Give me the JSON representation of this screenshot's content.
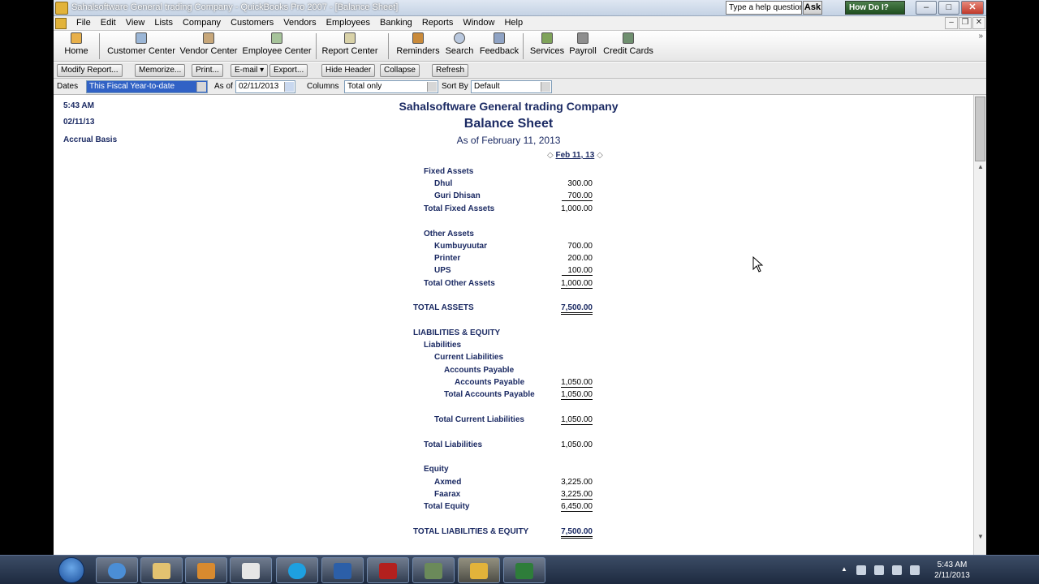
{
  "window": {
    "title": "Sahalsoftware General trading Company - QuickBooks Pro 2007 - [Balance Sheet]",
    "help_placeholder": "Type a help question",
    "ask_label": "Ask",
    "howdoi_label": "How Do I?"
  },
  "menu": [
    "File",
    "Edit",
    "View",
    "Lists",
    "Company",
    "Customers",
    "Vendors",
    "Employees",
    "Banking",
    "Reports",
    "Window",
    "Help"
  ],
  "iconbar": {
    "home": "Home",
    "customer_center": "Customer Center",
    "vendor_center": "Vendor Center",
    "employee_center": "Employee Center",
    "report_center": "Report Center",
    "reminders": "Reminders",
    "search": "Search",
    "feedback": "Feedback",
    "services": "Services",
    "payroll": "Payroll",
    "credit_cards": "Credit Cards",
    "more": "»"
  },
  "report_toolbar": {
    "modify": "Modify Report...",
    "memorize": "Memorize...",
    "print": "Print...",
    "email": "E-mail ▾",
    "export": "Export...",
    "hide_header": "Hide Header",
    "collapse": "Collapse",
    "refresh": "Refresh"
  },
  "filters": {
    "dates_label": "Dates",
    "dates_value": "This Fiscal Year-to-date",
    "as_of_label": "As of",
    "as_of_value": "02/11/2013",
    "columns_label": "Columns",
    "columns_value": "Total only",
    "sort_label": "Sort By",
    "sort_value": "Default"
  },
  "report": {
    "time": "5:43 AM",
    "date": "02/11/13",
    "basis": "Accrual Basis",
    "company": "Sahalsoftware General trading Company",
    "title": "Balance Sheet",
    "subtitle": "As of February 11, 2013",
    "column_header": "Feb 11, 13",
    "rows": [
      {
        "label": "Fixed Assets",
        "value": ""
      },
      {
        "label": "Dhul",
        "value": "300.00"
      },
      {
        "label": "Guri Dhisan",
        "value": "700.00"
      },
      {
        "label": "Total Fixed Assets",
        "value": "1,000.00"
      },
      {
        "label": "Other Assets",
        "value": ""
      },
      {
        "label": "Kumbuyuutar",
        "value": "700.00"
      },
      {
        "label": "Printer",
        "value": "200.00"
      },
      {
        "label": "UPS",
        "value": "100.00"
      },
      {
        "label": "Total Other Assets",
        "value": "1,000.00"
      },
      {
        "label": "TOTAL ASSETS",
        "value": "7,500.00"
      },
      {
        "label": "LIABILITIES & EQUITY",
        "value": ""
      },
      {
        "label": "Liabilities",
        "value": ""
      },
      {
        "label": "Current Liabilities",
        "value": ""
      },
      {
        "label": "Accounts Payable",
        "value": ""
      },
      {
        "label": "Accounts Payable",
        "value": "1,050.00"
      },
      {
        "label": "Total Accounts Payable",
        "value": "1,050.00"
      },
      {
        "label": "Total Current Liabilities",
        "value": "1,050.00"
      },
      {
        "label": "Total Liabilities",
        "value": "1,050.00"
      },
      {
        "label": "Equity",
        "value": ""
      },
      {
        "label": "Axmed",
        "value": "3,225.00"
      },
      {
        "label": "Faarax",
        "value": "3,225.00"
      },
      {
        "label": "Total Equity",
        "value": "6,450.00"
      },
      {
        "label": "TOTAL LIABILITIES & EQUITY",
        "value": "7,500.00"
      }
    ]
  },
  "taskbar": {
    "clock_time": "5:43 AM",
    "clock_date": "2/11/2013"
  },
  "colors": {
    "report_text": "#1b2a63",
    "selection": "#3162c5"
  }
}
